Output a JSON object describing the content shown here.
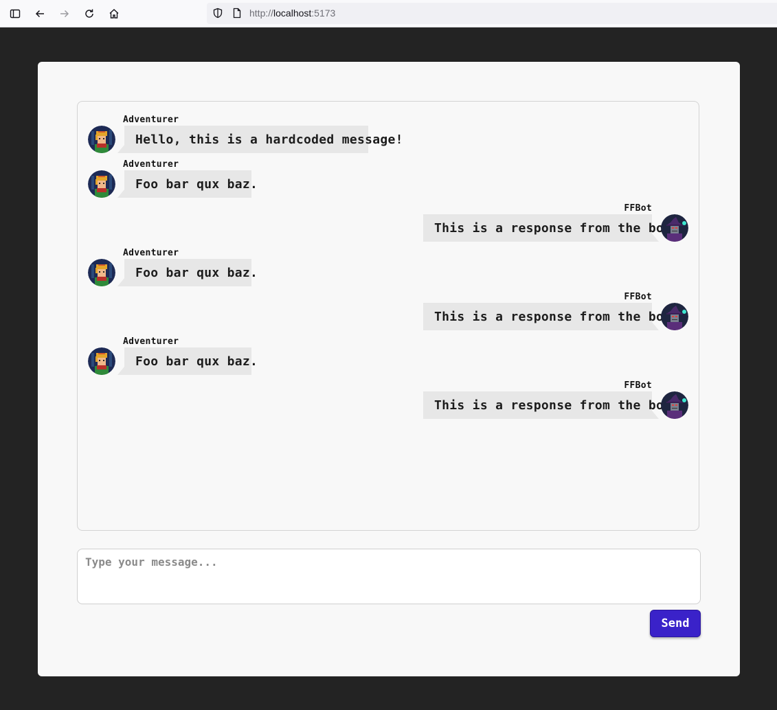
{
  "browser": {
    "url_scheme": "http://",
    "url_host": "localhost",
    "url_port": ":5173",
    "icons": [
      "sidebar-icon",
      "back-icon",
      "forward-icon",
      "reload-icon",
      "home-icon",
      "shield-icon",
      "page-icon"
    ]
  },
  "chat": {
    "messages": [
      {
        "sender": "Adventurer",
        "text": "Hello, this is a hardcoded message!",
        "side": "left",
        "avatar": "adventurer-avatar"
      },
      {
        "sender": "Adventurer",
        "text": "Foo bar qux baz.",
        "side": "left",
        "avatar": "adventurer-avatar"
      },
      {
        "sender": "FFBot",
        "text": "This is a response from the bot.",
        "side": "right",
        "avatar": "ffbot-avatar"
      },
      {
        "sender": "Adventurer",
        "text": "Foo bar qux baz.",
        "side": "left",
        "avatar": "adventurer-avatar"
      },
      {
        "sender": "FFBot",
        "text": "This is a response from the bot.",
        "side": "right",
        "avatar": "ffbot-avatar"
      },
      {
        "sender": "Adventurer",
        "text": "Foo bar qux baz.",
        "side": "left",
        "avatar": "adventurer-avatar"
      },
      {
        "sender": "FFBot",
        "text": "This is a response from the bot.",
        "side": "right",
        "avatar": "ffbot-avatar"
      }
    ]
  },
  "composer": {
    "placeholder": "Type your message...",
    "value": "",
    "send_label": "Send"
  },
  "colors": {
    "page_bg": "#232323",
    "panel_bg": "#f8f8f8",
    "bubble_bg": "#e7e7e7",
    "send_button": "#3a22c9"
  }
}
